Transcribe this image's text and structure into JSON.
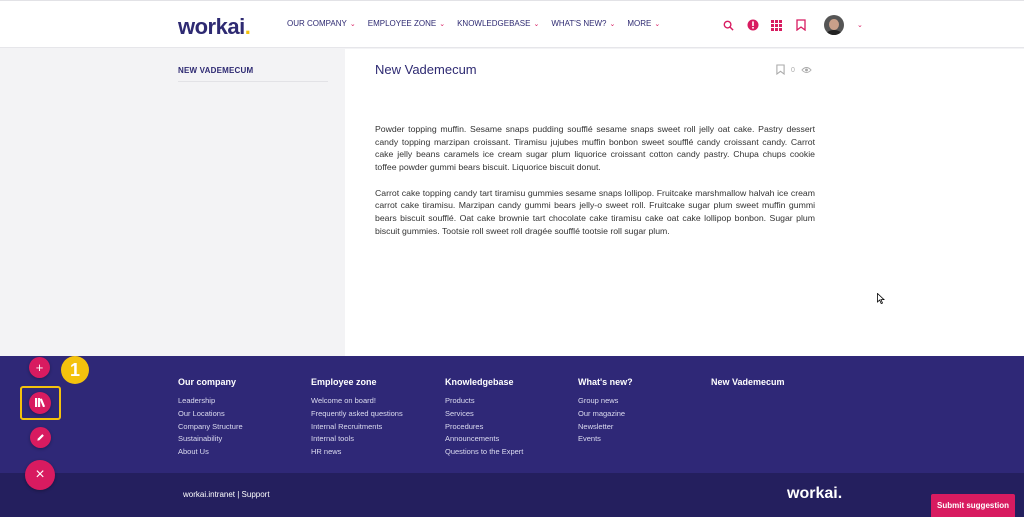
{
  "header": {
    "logo": "workai",
    "logo_dot": ".",
    "nav": [
      {
        "label": "OUR COMPANY"
      },
      {
        "label": "EMPLOYEE ZONE"
      },
      {
        "label": "KNOWLEDGEBASE"
      },
      {
        "label": "WHAT'S NEW?"
      },
      {
        "label": "MORE"
      }
    ],
    "icons": [
      "search-icon",
      "alert-icon",
      "apps-grid-icon",
      "bookmark-icon",
      "avatar"
    ]
  },
  "sidebar": {
    "title": "NEW VADEMECUM"
  },
  "article": {
    "title": "New Vademecum",
    "view_count": "0",
    "paragraphs": [
      "Powder topping muffin. Sesame snaps pudding soufflé sesame snaps sweet roll jelly oat cake. Pastry dessert candy topping marzipan croissant. Tiramisu jujubes muffin bonbon sweet soufflé candy croissant candy. Carrot cake jelly beans caramels ice cream sugar plum liquorice croissant cotton candy pastry. Chupa chups cookie toffee powder gummi bears biscuit. Liquorice biscuit donut.",
      "Carrot cake topping candy tart tiramisu gummies sesame snaps lollipop. Fruitcake marshmallow halvah ice cream carrot cake tiramisu. Marzipan candy gummi bears jelly-o sweet roll. Fruitcake sugar plum sweet muffin gummi bears biscuit soufflé. Oat cake brownie tart chocolate cake tiramisu cake oat cake lollipop bonbon. Sugar plum biscuit gummies. Tootsie roll sweet roll dragée soufflé tootsie roll sugar plum."
    ]
  },
  "footer": {
    "columns": [
      {
        "title": "Our company",
        "links": [
          "Leadership",
          "Our Locations",
          "Company Structure",
          "Sustainability",
          "About Us"
        ]
      },
      {
        "title": "Employee zone",
        "links": [
          "Welcome on board!",
          "Frequently asked questions",
          "Internal Recruitments",
          "Internal tools",
          "HR news"
        ]
      },
      {
        "title": "Knowledgebase",
        "links": [
          "Products",
          "Services",
          "Procedures",
          "Announcements",
          "Questions to the Expert"
        ]
      },
      {
        "title": "What's new?",
        "links": [
          "Group news",
          "Our magazine",
          "Newsletter",
          "Events"
        ]
      },
      {
        "title": "New Vademecum",
        "links": []
      }
    ],
    "bottom_text": "workai.intranet  |  Support",
    "bottom_logo": "workai.",
    "submit_label": "Submit suggestion"
  },
  "fab": {
    "add_label": "+",
    "close_label": "×",
    "step_number": "1"
  },
  "colors": {
    "brand_navy": "#2e2a72",
    "accent_pink": "#d81b60",
    "highlight_yellow": "#f4c20d",
    "footer_bg": "#2f2877"
  }
}
